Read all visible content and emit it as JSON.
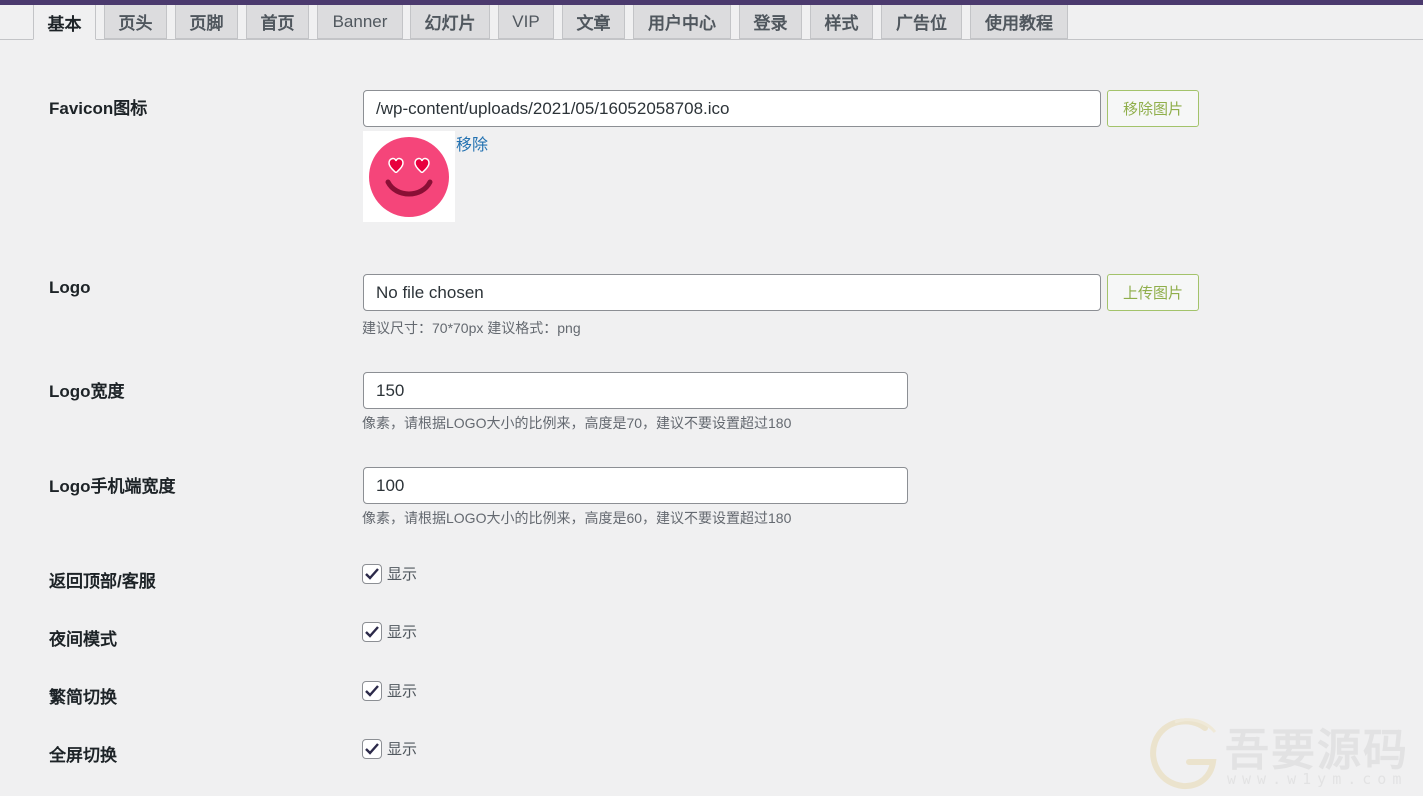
{
  "tabs": [
    {
      "label": "基本",
      "active": true
    },
    {
      "label": "页头"
    },
    {
      "label": "页脚"
    },
    {
      "label": "首页"
    },
    {
      "label": "Banner"
    },
    {
      "label": "幻灯片"
    },
    {
      "label": "VIP"
    },
    {
      "label": "文章"
    },
    {
      "label": "用户中心"
    },
    {
      "label": "登录"
    },
    {
      "label": "样式"
    },
    {
      "label": "广告位"
    },
    {
      "label": "使用教程"
    }
  ],
  "favicon": {
    "label": "Favicon图标",
    "value": "/wp-content/uploads/2021/05/16052058708.ico",
    "remove_image_button": "移除图片",
    "remove_link": "移除",
    "preview_icon": "heart-eyes-emoji-icon"
  },
  "logo": {
    "label": "Logo",
    "value": "No file chosen",
    "upload_button": "上传图片",
    "hint": "建议尺寸：70*70px 建议格式：png"
  },
  "logo_width": {
    "label": "Logo宽度",
    "value": "150",
    "hint": "像素，请根据LOGO大小的比例来，高度是70，建议不要设置超过180"
  },
  "logo_mobile_width": {
    "label": "Logo手机端宽度",
    "value": "100",
    "hint": "像素，请根据LOGO大小的比例来，高度是60，建议不要设置超过180"
  },
  "toggles": [
    {
      "label": "返回顶部/客服",
      "option": "显示",
      "checked": true
    },
    {
      "label": "夜间模式",
      "option": "显示",
      "checked": true
    },
    {
      "label": "繁简切换",
      "option": "显示",
      "checked": true
    },
    {
      "label": "全屏切换",
      "option": "显示",
      "checked": true
    }
  ],
  "watermark": {
    "text": "吾要源码",
    "url": "www.w1ym.com"
  },
  "colors": {
    "topbar": "#4b3a6e",
    "accent_button": "#8fae4a",
    "link": "#2271b1",
    "checkmark": "#2c2a4a",
    "emoji_face": "#f5457a"
  }
}
